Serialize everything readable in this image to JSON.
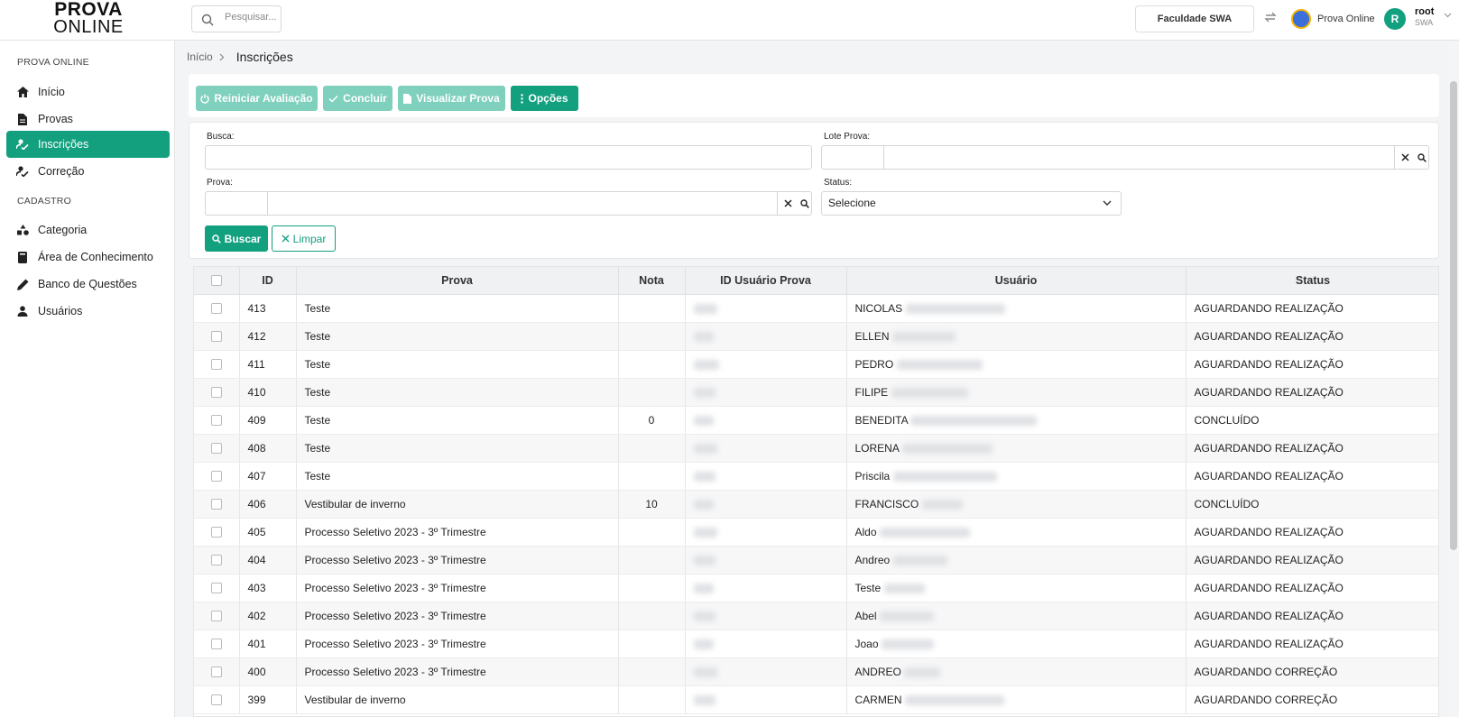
{
  "brand": {
    "line1": "PROVA",
    "line2": "ONLINE"
  },
  "header": {
    "search_placeholder": "Pesquisar...",
    "institution": "Faculdade SWA",
    "app_name": "Prova Online",
    "avatar_letter": "R",
    "user_name": "root",
    "user_org": "SWA"
  },
  "sidebar": {
    "section1": "PROVA ONLINE",
    "section2": "CADASTRO",
    "items": [
      {
        "label": "Início",
        "icon": "home-icon"
      },
      {
        "label": "Provas",
        "icon": "file-icon"
      },
      {
        "label": "Inscrições",
        "icon": "enroll-icon",
        "active": true
      },
      {
        "label": "Correção",
        "icon": "correction-icon"
      },
      {
        "label": "Categoria",
        "icon": "shapes-icon"
      },
      {
        "label": "Área de Conhecimento",
        "icon": "book-icon"
      },
      {
        "label": "Banco de Questões",
        "icon": "pencil-icon"
      },
      {
        "label": "Usuários",
        "icon": "user-icon"
      }
    ]
  },
  "breadcrumb": {
    "home": "Início",
    "current": "Inscrições"
  },
  "toolbar": {
    "restart": "Reiniciar Avaliação",
    "conclude": "Concluir",
    "view": "Visualizar Prova",
    "options": "Opções"
  },
  "filters": {
    "busca_label": "Busca:",
    "lote_label": "Lote Prova:",
    "prova_label": "Prova:",
    "status_label": "Status:",
    "status_value": "Selecione",
    "search_button": "Buscar",
    "clear_button": "Limpar"
  },
  "table": {
    "columns": [
      "ID",
      "Prova",
      "Nota",
      "ID Usuário Prova",
      "Usuário",
      "Status"
    ],
    "rows": [
      {
        "id": "413",
        "prova": "Teste",
        "nota": "",
        "usuario": "NICOLAS",
        "status": "AGUARDANDO REALIZAÇÃO"
      },
      {
        "id": "412",
        "prova": "Teste",
        "nota": "",
        "usuario": "ELLEN",
        "status": "AGUARDANDO REALIZAÇÃO"
      },
      {
        "id": "411",
        "prova": "Teste",
        "nota": "",
        "usuario": "PEDRO",
        "status": "AGUARDANDO REALIZAÇÃO"
      },
      {
        "id": "410",
        "prova": "Teste",
        "nota": "",
        "usuario": "FILIPE",
        "status": "AGUARDANDO REALIZAÇÃO"
      },
      {
        "id": "409",
        "prova": "Teste",
        "nota": "0",
        "usuario": "BENEDITA",
        "status": "CONCLUÍDO"
      },
      {
        "id": "408",
        "prova": "Teste",
        "nota": "",
        "usuario": "LORENA",
        "status": "AGUARDANDO REALIZAÇÃO"
      },
      {
        "id": "407",
        "prova": "Teste",
        "nota": "",
        "usuario": "Priscila",
        "status": "AGUARDANDO REALIZAÇÃO"
      },
      {
        "id": "406",
        "prova": "Vestibular de inverno",
        "nota": "10",
        "usuario": "FRANCISCO",
        "status": "CONCLUÍDO"
      },
      {
        "id": "405",
        "prova": "Processo Seletivo 2023 - 3º Trimestre",
        "nota": "",
        "usuario": "Aldo",
        "status": "AGUARDANDO REALIZAÇÃO"
      },
      {
        "id": "404",
        "prova": "Processo Seletivo 2023 - 3º Trimestre",
        "nota": "",
        "usuario": "Andreo",
        "status": "AGUARDANDO REALIZAÇÃO"
      },
      {
        "id": "403",
        "prova": "Processo Seletivo 2023 - 3º Trimestre",
        "nota": "",
        "usuario": "Teste",
        "status": "AGUARDANDO REALIZAÇÃO"
      },
      {
        "id": "402",
        "prova": "Processo Seletivo 2023 - 3º Trimestre",
        "nota": "",
        "usuario": "Abel",
        "status": "AGUARDANDO REALIZAÇÃO"
      },
      {
        "id": "401",
        "prova": "Processo Seletivo 2023 - 3º Trimestre",
        "nota": "",
        "usuario": "Joao",
        "status": "AGUARDANDO REALIZAÇÃO"
      },
      {
        "id": "400",
        "prova": "Processo Seletivo 2023 - 3º Trimestre",
        "nota": "",
        "usuario": "ANDREO",
        "status": "AGUARDANDO CORREÇÃO"
      },
      {
        "id": "399",
        "prova": "Vestibular de inverno",
        "nota": "",
        "usuario": "CARMEN",
        "status": "AGUARDANDO CORREÇÃO"
      }
    ]
  },
  "colors": {
    "primary": "#13a07f",
    "primary_disabled": "#7fd0bd"
  }
}
